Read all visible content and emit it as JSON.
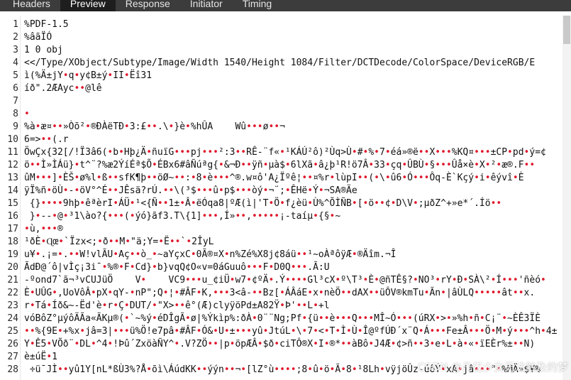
{
  "tabs": [
    {
      "label": "Headers",
      "active": false
    },
    {
      "label": "Preview",
      "active": true
    },
    {
      "label": "Response",
      "active": false
    },
    {
      "label": "Initiator",
      "active": false
    },
    {
      "label": "Timing",
      "active": false
    }
  ],
  "lines": [
    {
      "n": "1",
      "text": "%PDF-1.5"
    },
    {
      "n": "2",
      "text": "%âãÏÓ"
    },
    {
      "n": "3",
      "text": "1 0 obj"
    },
    {
      "n": "4",
      "text": "<</Type/XObject/Subtype/Image/Width 1540/Height 1084/Filter/DCTDecode/ColorSpace/DeviceRGB/E"
    },
    {
      "n": "5",
      "text": "ì(%Ä±jY•q•y¢B±ý•II•Ëî31"
    },
    {
      "n": "6",
      "text": "íð\".2ÆAyc••@lê"
    },
    {
      "n": "7",
      "text": ""
    },
    {
      "n": "8",
      "text": "•"
    },
    {
      "n": "9",
      "text": "%à•æ¤••»Òõ²•®ÐÀëTÐ•3:£••.\\•}è•%hÛA    Wû•••ø••¬"
    },
    {
      "n": "10",
      "text": "6=>••(.r"
    },
    {
      "n": "11",
      "text": "ÖwÇx{32[/!Ï3â6(•b•Hþ¿Ä•ñuïG•••pj•••²:3••RÊ-¨f«•¹KÁÚ²ô)²Ùq>Ù•#•%•7•éá»®ë••X•••%KQ¤•••±CP•pd•ý=¢"
    },
    {
      "n": "12",
      "text": "ö••Ì»ÌÁü}•t^¨?%æ2ÝíÉª$Õ•ÉBx6#âÑúªg{•&¬Ð••ÿñ•µà$•6lXã•â¿þ¹R!ö7Â•33•çq•ÛBÙ•§•••Ûå×è•X•²•æ®.F••"
    },
    {
      "n": "13",
      "text": "ûM•••]•ÈŠ•ø%l•ß••sfK¶þ••öØ~••:•8•è•••^®.w¤ô'A¿Ïºê¦••¤%r•lùpI••(•\\•û6•Ó•••Ôq-È`Kçý•i•êývî•È"
    },
    {
      "n": "14",
      "text": "ÿÏ%ñ•öÙ•-•öV°^É••JÊsä?rÚ.••\\(³$•••û•p$•••òý•¬¨;•ÊHë•Ý•¬SA®Äe"
    },
    {
      "n": "15",
      "text": " {}••••9hþ•êªèrI•ÁÜ•¹<{Ñ••1±•Â•ëÓqa8|ºÆ(ì|'T•Ö•f¿èü•Ù%^ÕÌÑB•[•ö••¢•D\\V•;µðZ^+»e*´.Íö••"
    },
    {
      "n": "16",
      "text": " }•--•@•³1\\ào?{•••(•ýó}ãf3.T\\{1]•••,Í»••,•••••¡-taíµ•{§•~"
    },
    {
      "n": "17",
      "text": "•ù,•••®"
    },
    {
      "n": "18",
      "text": "¹ðÈ•Ɋœ•`Ïzx<;•ð••M•\"ä;Y=•Ë••`•2ÎyL"
    },
    {
      "n": "19",
      "text": "u¥•.¡=•.••W!vlÃU•Aç••ò_•~aYçxC•0Ã®¤X•n%Zé%X8j¢8áü••¹~oÀªôÿÆ•®Äîm.¬Î"
    },
    {
      "n": "20",
      "text": "ÃdÐ@´ô|vÌç¡3i¯•%®•F•Cd}•b}vqQ¢O«v=0áGuuô•••F•D0Q•••.Ã:U"
    },
    {
      "n": "21",
      "text": "-ºond7`ã¬³vCUJüÖ    V•    VC9•••u_¢iÜ•w7•¢ºÄ•.Ý••••Gl³cX•º\\T³•È•@ñTÊ§?•NO³•rY•Ð•SÀ\\²•Í•••'ñèó•"
    },
    {
      "n": "22",
      "text": "È•UÛG•,UoVôÂ•pX•qY-•nP\";Q•¦•#ÂF•K,•••3<â-••Bz[•ÁÂáE•x•nèÖ••dAX••üÔV®kmTu•Ãn•|âÙLQ•••••ât••x."
    },
    {
      "n": "23",
      "text": "r•Tá•Íð&~-Ëd'è•r•Ç•DUT/•\"X>••ê°(Æ)clyÿöPd±A82Ÿ•Þ'••L•+l"
    },
    {
      "n": "24",
      "text": "vóBôZ°µýôÄÃa«ÃKµ®(•`~%ý•éDÎgÃ•ø|%Ýkìp%:ðÀ•0¨¨Ng;Pf•{ü••è•••Q•••MÎ~Ó•••(úRX•>•»%h•ñ•C¡¨•~ÈÊ3ÏÈ"
    },
    {
      "n": "25",
      "text": "••%{9E•+%x•jâ=3|•••ü%Ö!e7pâ•#ÂF•Ó&•U•±•••yû•JtúL•\\•7•<•T•Ì•Ù•Î@ºfÚÐ´x¨Q•Á•••Fe±Â•••Ö•M•ý•••^h•4±"
    },
    {
      "n": "26",
      "text": "Y•Ê5•VÕð¨•DL•^4•!Þû´ZxöàÑY^•.V?ZÖ••|p•öpÆÂ•$ð•ciTÔ®X•I•®*••àBô•J4Æ•¢>ñ••3•e•L•à•«•ïEÈr%±••N)"
    },
    {
      "n": "27",
      "text": "è±úË•1"
    },
    {
      "n": "28",
      "text": " ÷ü¯JÌ••yû1Y[nL*ßÙ3%?Å•õì\\ÁúdKK••ýýn••¬•[lZ°ù••••;8•û•ö•Ã•8•¹8Lh•vÿjöÛz-úôÝ•xÁ•jâ•••\"•%MÄ»$¥%"
    }
  ],
  "watermark": "CSDN @几亿少女无法触及的梦"
}
